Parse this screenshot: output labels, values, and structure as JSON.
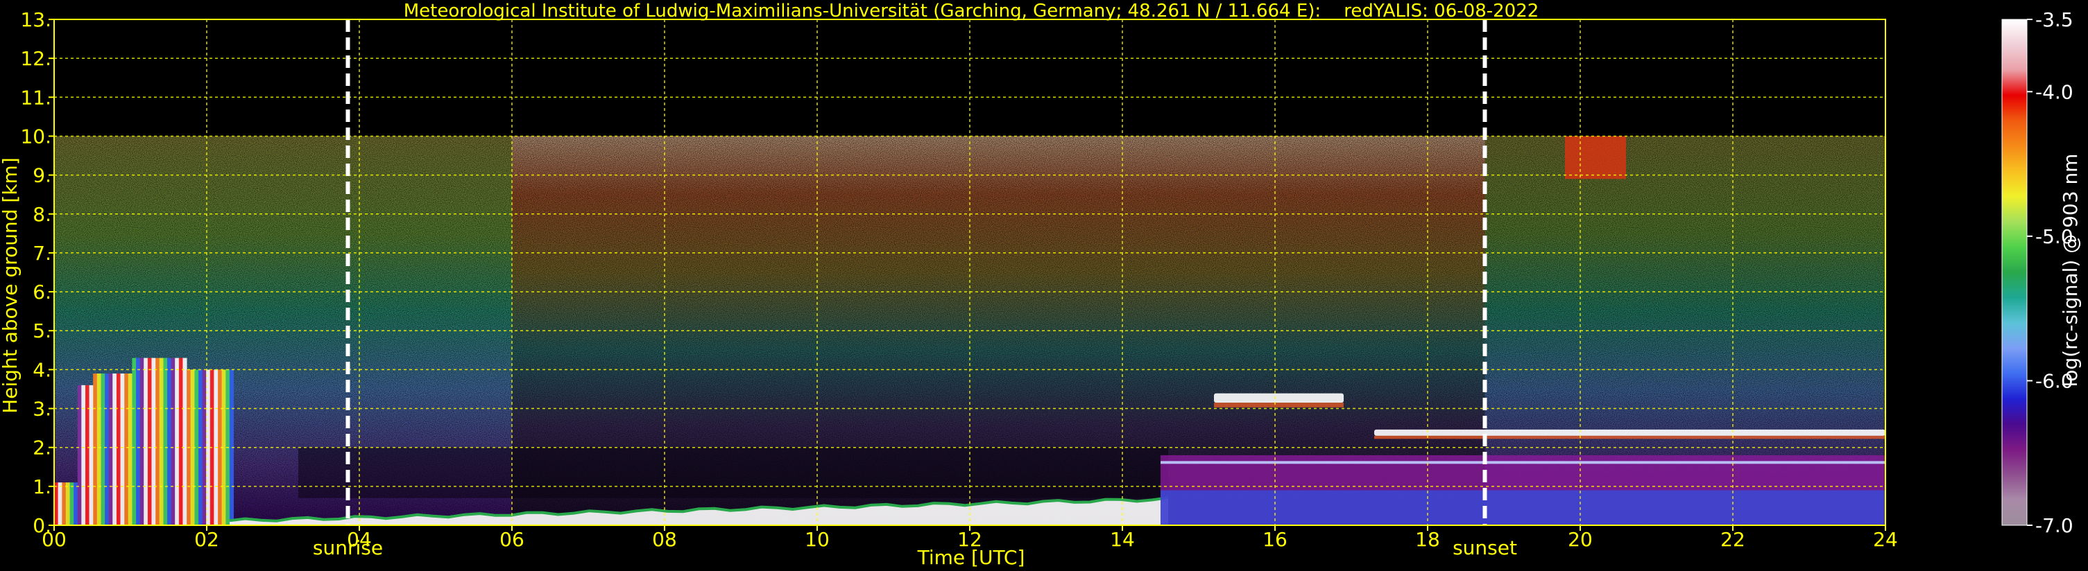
{
  "chart_data": {
    "type": "heatmap",
    "title": "Meteorological Institute of Ludwig-Maximilians-Universität (Garching, Germany; 48.261 N / 11.664 E):    redYALIS: 06-08-2022",
    "xlabel": "Time [UTC]",
    "ylabel": "Height above ground [km]",
    "xlim": [
      0,
      24
    ],
    "ylim": [
      0,
      13
    ],
    "x_ticks": [
      "00",
      "02",
      "04",
      "06",
      "08",
      "10",
      "12",
      "14",
      "16",
      "18",
      "20",
      "22",
      "24"
    ],
    "y_ticks": [
      "0.",
      "1.",
      "2.",
      "3.",
      "4.",
      "5.",
      "6.",
      "7.",
      "8.",
      "9.",
      "10.",
      "11.",
      "12.",
      "13."
    ],
    "grid": true,
    "data_max_height_km": 10,
    "markers": [
      {
        "label": "sunrise",
        "x": 3.85
      },
      {
        "label": "sunset",
        "x": 18.75
      }
    ],
    "colorbar": {
      "label": "log(rc-signal) @ 903 nm",
      "range": [
        -7.0,
        -3.5
      ],
      "ticks": [
        "-3.5",
        "-4.0",
        "-5.0",
        "-6.0",
        "-7.0"
      ],
      "tick_values": [
        -3.5,
        -4.0,
        -5.0,
        -6.0,
        -7.0
      ]
    },
    "features": [
      {
        "name": "precipitation",
        "x": [
          0,
          2.35
        ],
        "y": [
          0,
          4.6
        ]
      },
      {
        "name": "boundary-layer",
        "x": [
          2.3,
          14.6
        ],
        "y": [
          0,
          0.7
        ]
      },
      {
        "name": "cloud-layer",
        "x": [
          15.2,
          16.9
        ],
        "y": [
          3.0,
          3.6
        ]
      },
      {
        "name": "cloud-layer",
        "x": [
          17.3,
          24
        ],
        "y": [
          2.2,
          2.6
        ]
      },
      {
        "name": "residual-layer",
        "x": [
          14.5,
          24
        ],
        "y": [
          0,
          1.8
        ]
      },
      {
        "name": "cloud-patch",
        "x": [
          19.8,
          20.6
        ],
        "y": [
          8.9,
          10
        ]
      }
    ],
    "colors": {
      "text": "#ffff00",
      "grid": "#ffff00",
      "marker": "#ffffff",
      "background": "#000000",
      "colormap": [
        "#9c8d9c",
        "#a98aa8",
        "#8f4f90",
        "#7c1a84",
        "#4a0a8f",
        "#2022d4",
        "#3f6ef0",
        "#7c9ef5",
        "#5cc3d9",
        "#1ea893",
        "#2aa84c",
        "#4fd14a",
        "#a5e05a",
        "#f0f02a",
        "#f8c020",
        "#f58a18",
        "#f05a10",
        "#e80000",
        "#eaa0a8",
        "#f0d0d8",
        "#ffffff"
      ]
    }
  }
}
